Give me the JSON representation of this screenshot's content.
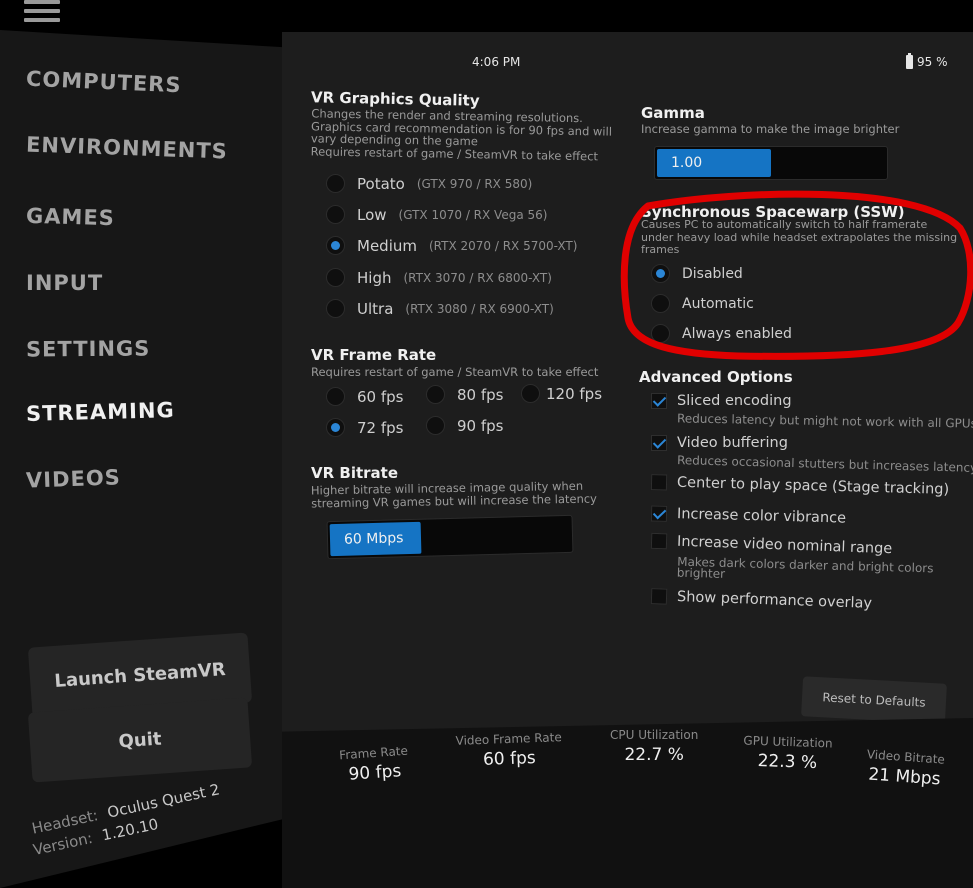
{
  "sidebar": {
    "items": [
      {
        "label": "COMPUTERS"
      },
      {
        "label": "ENVIRONMENTS"
      },
      {
        "label": "GAMES"
      },
      {
        "label": "INPUT"
      },
      {
        "label": "SETTINGS"
      },
      {
        "label": "STREAMING"
      },
      {
        "label": "VIDEOS"
      }
    ],
    "active": "STREAMING",
    "launch_label": "Launch SteamVR",
    "quit_label": "Quit",
    "headset_label": "Headset:",
    "headset_value": "Oculus Quest 2",
    "version_label": "Version:",
    "version_value": "1.20.10"
  },
  "status": {
    "time": "4:06 PM",
    "battery": "95 %"
  },
  "graphics": {
    "title": "VR Graphics Quality",
    "desc1": "Changes the render and streaming resolutions.",
    "desc2": "Graphics card recommendation is for 90 fps and will",
    "desc3": "vary depending on the game",
    "desc4": "Requires restart of game / SteamVR to take effect",
    "options": [
      {
        "label": "Potato",
        "gpu": "(GTX 970 / RX 580)",
        "selected": false
      },
      {
        "label": "Low",
        "gpu": "(GTX 1070 / RX Vega 56)",
        "selected": false
      },
      {
        "label": "Medium",
        "gpu": "(RTX 2070 / RX 5700-XT)",
        "selected": true
      },
      {
        "label": "High",
        "gpu": "(RTX 3070 / RX 6800-XT)",
        "selected": false
      },
      {
        "label": "Ultra",
        "gpu": "(RTX 3080 / RX 6900-XT)",
        "selected": false
      }
    ]
  },
  "framerate": {
    "title": "VR Frame Rate",
    "desc": "Requires restart of game / SteamVR to take effect",
    "options": [
      {
        "label": "60 fps",
        "selected": false
      },
      {
        "label": "80 fps",
        "selected": false
      },
      {
        "label": "120 fps",
        "selected": false
      },
      {
        "label": "72 fps",
        "selected": true
      },
      {
        "label": "90 fps",
        "selected": false
      }
    ]
  },
  "bitrate": {
    "title": "VR Bitrate",
    "desc1": "Higher bitrate will increase image quality when",
    "desc2": "streaming VR games but will increase the latency",
    "value": "60 Mbps",
    "fill_fraction": 0.38
  },
  "gamma": {
    "title": "Gamma",
    "desc": "Increase gamma to make the image brighter",
    "value": "1.00",
    "fill_fraction": 0.5
  },
  "ssw": {
    "title": "Synchronous Spacewarp (SSW)",
    "desc1": "Causes PC to automatically switch to half framerate",
    "desc2": "under heavy load while headset extrapolates the missing",
    "desc3": "frames",
    "options": [
      {
        "label": "Disabled",
        "selected": true
      },
      {
        "label": "Automatic",
        "selected": false
      },
      {
        "label": "Always enabled",
        "selected": false
      }
    ],
    "highlight_color": "#e00000"
  },
  "advanced": {
    "title": "Advanced Options",
    "options": [
      {
        "label": "Sliced encoding",
        "checked": true,
        "sub": "Reduces latency but might not work with all GPUs"
      },
      {
        "label": "Video buffering",
        "checked": true,
        "sub": "Reduces occasional stutters but increases latency"
      },
      {
        "label": "Center to play space (Stage tracking)",
        "checked": false,
        "sub": ""
      },
      {
        "label": "Increase color vibrance",
        "checked": true,
        "sub": ""
      },
      {
        "label": "Increase video nominal range",
        "checked": false,
        "sub": "Makes dark colors darker and bright colors",
        "sub2": "brighter"
      },
      {
        "label": "Show performance overlay",
        "checked": false,
        "sub": ""
      }
    ],
    "reset_label": "Reset to Defaults"
  },
  "stats": [
    {
      "label": "Frame Rate",
      "value": "90 fps"
    },
    {
      "label": "Video Frame Rate",
      "value": "60 fps"
    },
    {
      "label": "CPU Utilization",
      "value": "22.7 %"
    },
    {
      "label": "GPU Utilization",
      "value": "22.3 %"
    },
    {
      "label": "Video Bitrate",
      "value": "21 Mbps"
    }
  ],
  "colors": {
    "accent": "#1574c4",
    "radio_on": "#2b86d6"
  }
}
